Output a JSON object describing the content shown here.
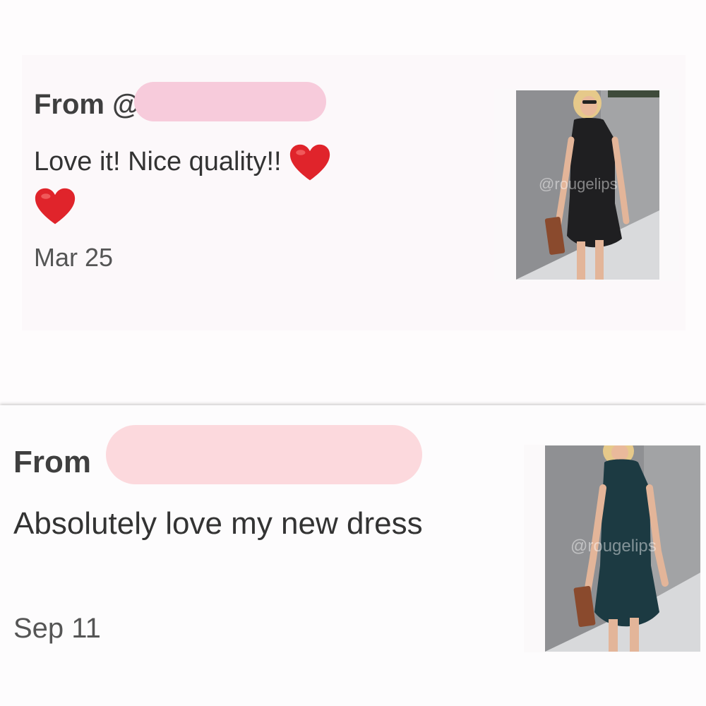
{
  "reviews": [
    {
      "from_label": "From @",
      "text": "Love it! Nice quality!!",
      "emoji": [
        "red-heart",
        "red-heart"
      ],
      "date": "Mar 25",
      "photo_watermark": "@rougelips",
      "dress_color": "#1f1f21"
    },
    {
      "from_label": "From",
      "text": "Absolutely love my new dress",
      "date": "Sep 11",
      "photo_watermark": "@rougelips",
      "dress_color": "#1c3a42"
    }
  ],
  "colors": {
    "redaction_1": "#f7cbdb",
    "redaction_2": "#fcd9dd",
    "heart": "#e0242b"
  }
}
